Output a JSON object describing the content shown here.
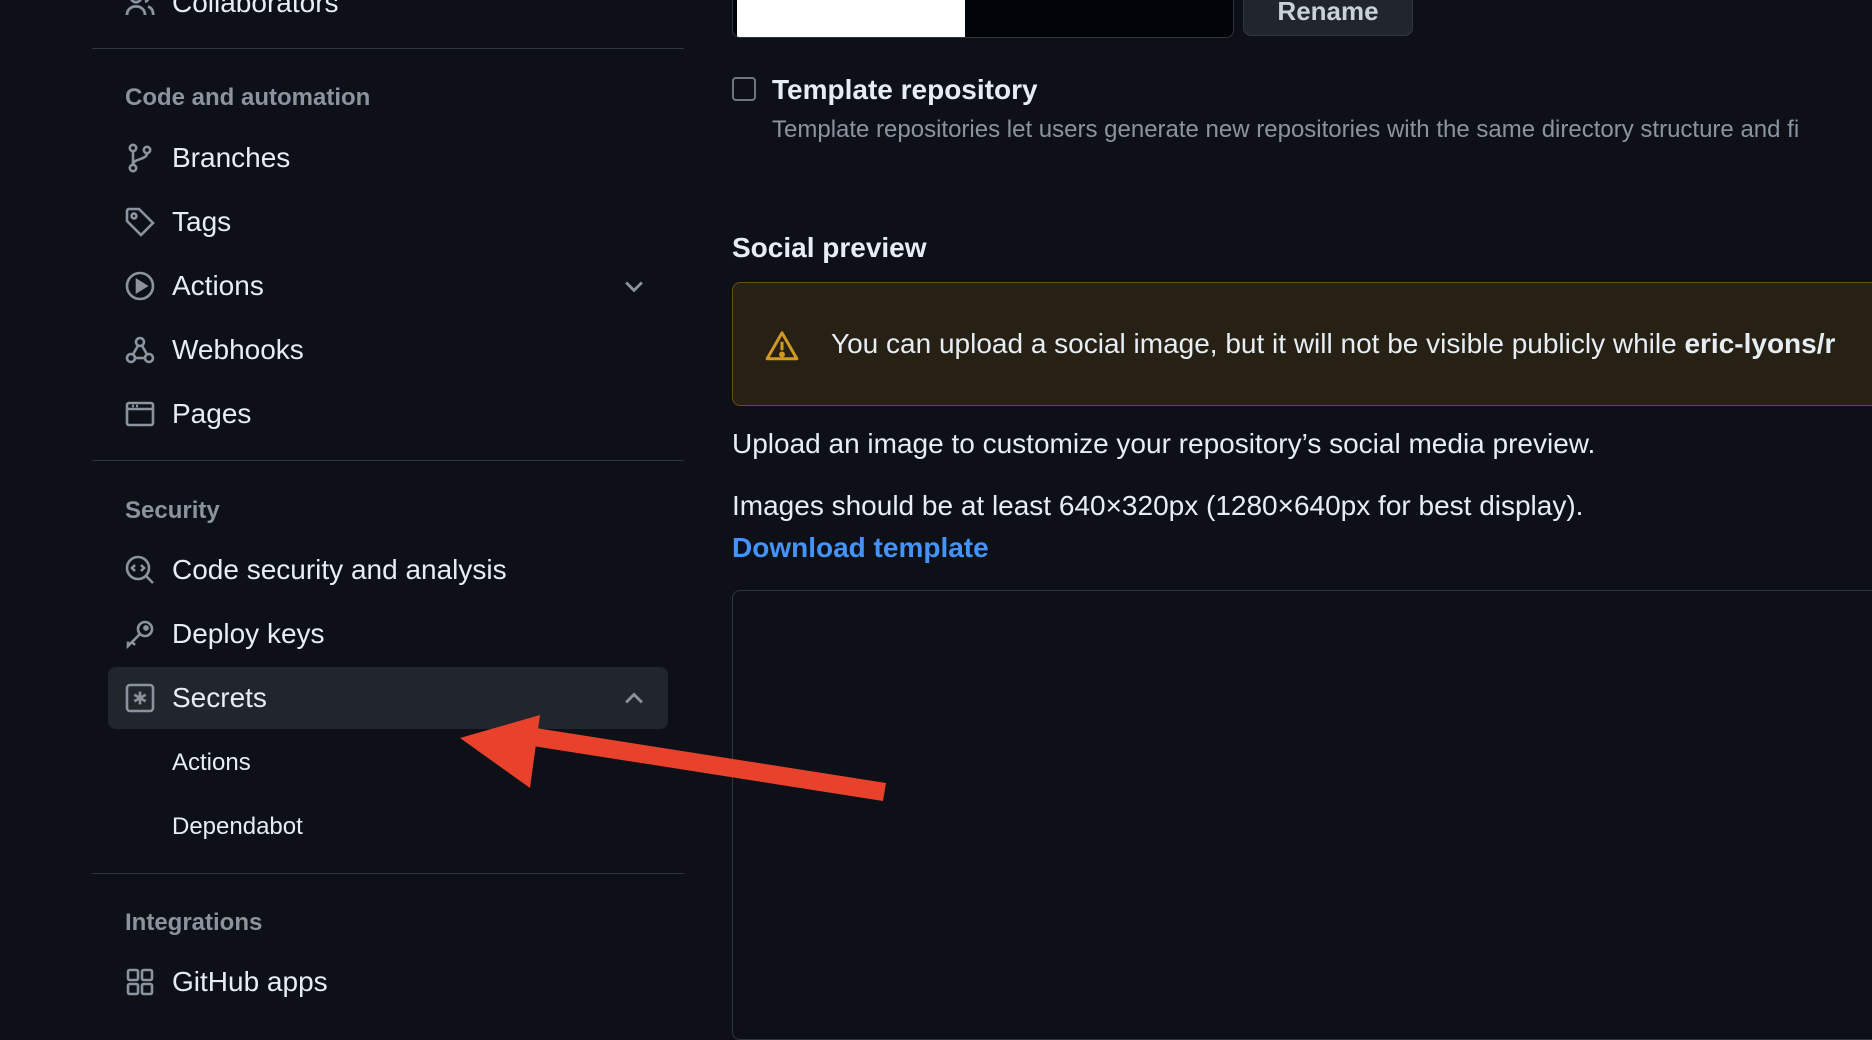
{
  "sidebar": {
    "top_item": {
      "label": "Collaborators",
      "icon": "people-icon"
    },
    "sections": {
      "code": {
        "title": "Code and automation",
        "items": [
          {
            "label": "Branches",
            "icon": "git-branch-icon"
          },
          {
            "label": "Tags",
            "icon": "tag-icon"
          },
          {
            "label": "Actions",
            "icon": "play-icon"
          },
          {
            "label": "Webhooks",
            "icon": "webhook-icon"
          },
          {
            "label": "Pages",
            "icon": "browser-icon"
          }
        ]
      },
      "security": {
        "title": "Security",
        "items": [
          {
            "label": "Code security and analysis",
            "icon": "codescan-icon"
          },
          {
            "label": "Deploy keys",
            "icon": "key-icon"
          },
          {
            "label": "Secrets",
            "icon": "asterisk-box-icon"
          }
        ],
        "secrets_sub": [
          {
            "label": "Actions"
          },
          {
            "label": "Dependabot"
          }
        ]
      },
      "integrations": {
        "title": "Integrations",
        "items": [
          {
            "label": "GitHub apps",
            "icon": "apps-icon"
          }
        ]
      }
    }
  },
  "main": {
    "rename_label": "Rename",
    "template": {
      "title": "Template repository",
      "description": "Template repositories let users generate new repositories with the same directory structure and fi"
    },
    "social": {
      "title": "Social preview",
      "warning_prefix": "You can upload a social image, but it will not be visible publicly while ",
      "warning_repo": "eric-lyons/r",
      "upload_text": "Upload an image to customize your repository’s social media preview.",
      "size_text": "Images should be at least 640×320px (1280×640px for best display).",
      "download_link": "Download template"
    }
  },
  "colors": {
    "background": "#0d1117",
    "link": "#4493f8",
    "warning": "#d29922",
    "arrow": "#e8412c"
  }
}
